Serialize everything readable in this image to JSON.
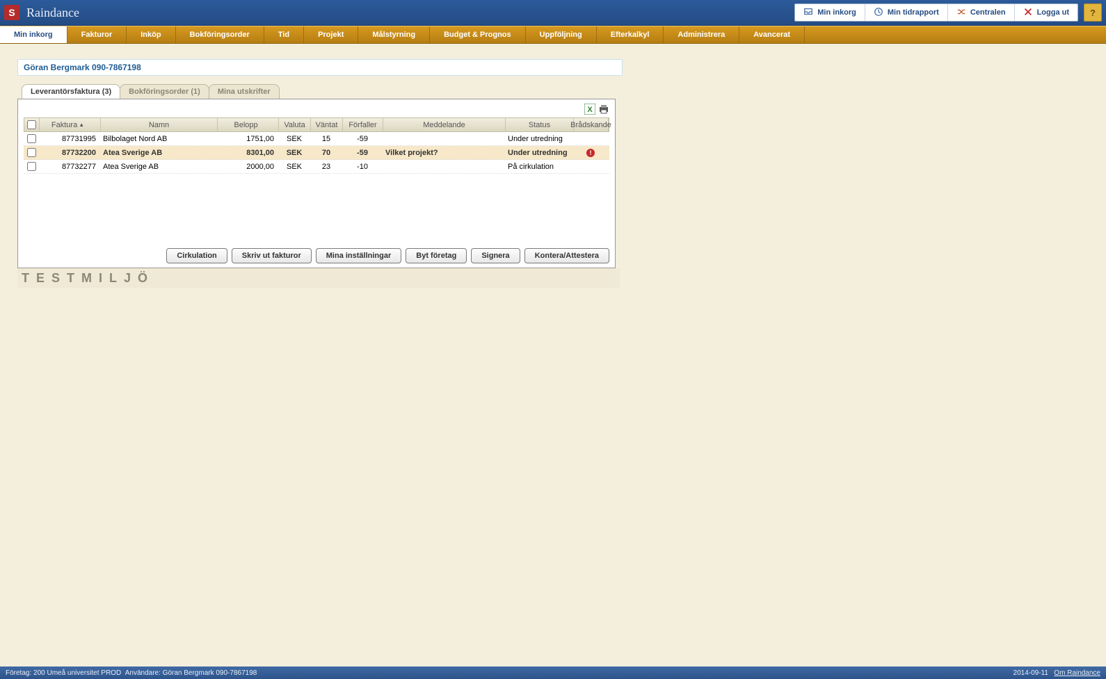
{
  "app": {
    "title": "Raindance"
  },
  "topButtons": [
    {
      "label": "Min inkorg",
      "icon": "inbox"
    },
    {
      "label": "Min tidrapport",
      "icon": "clock"
    },
    {
      "label": "Centralen",
      "icon": "shuffle"
    },
    {
      "label": "Logga ut",
      "icon": "close"
    }
  ],
  "help": "?",
  "nav": [
    "Min inkorg",
    "Fakturor",
    "Inköp",
    "Bokföringsorder",
    "Tid",
    "Projekt",
    "Målstyrning",
    "Budget & Prognos",
    "Uppföljning",
    "Efterkalkyl",
    "Administrera",
    "Avancerat"
  ],
  "navActive": 0,
  "breadcrumb": "Göran Bergmark 090-7867198",
  "tabs": [
    {
      "label": "Leverantörsfaktura (3)",
      "active": true
    },
    {
      "label": "Bokföringsorder (1)",
      "active": false
    },
    {
      "label": "Mina utskrifter",
      "active": false
    }
  ],
  "grid": {
    "headers": {
      "faktura": "Faktura",
      "namn": "Namn",
      "belopp": "Belopp",
      "valuta": "Valuta",
      "vantat": "Väntat",
      "forfaller": "Förfaller",
      "meddelande": "Meddelande",
      "status": "Status",
      "bradskande": "Brådskande"
    },
    "rows": [
      {
        "faktura": "87731995",
        "namn": "Bilbolaget Nord AB",
        "belopp": "1751,00",
        "valuta": "SEK",
        "vantat": "15",
        "forfaller": "-59",
        "meddelande": "",
        "status": "Under utredning",
        "urgent": false,
        "selected": false
      },
      {
        "faktura": "87732200",
        "namn": "Atea Sverige AB",
        "belopp": "8301,00",
        "valuta": "SEK",
        "vantat": "70",
        "forfaller": "-59",
        "meddelande": "Vilket projekt?",
        "status": "Under utredning",
        "urgent": true,
        "selected": true
      },
      {
        "faktura": "87732277",
        "namn": "Atea Sverige AB",
        "belopp": "2000,00",
        "valuta": "SEK",
        "vantat": "23",
        "forfaller": "-10",
        "meddelande": "",
        "status": "På cirkulation",
        "urgent": false,
        "selected": false
      }
    ]
  },
  "panelButtons": [
    "Cirkulation",
    "Skriv ut fakturor",
    "Mina inställningar",
    "Byt företag",
    "Signera",
    "Kontera/Attestera"
  ],
  "testLabel": "TESTMILJÖ",
  "status": {
    "company": "Företag: 200 Umeå universitet PROD",
    "user": "Användare: Göran Bergmark 090-7867198",
    "date": "2014-09-11",
    "about": "Om Raindance"
  }
}
